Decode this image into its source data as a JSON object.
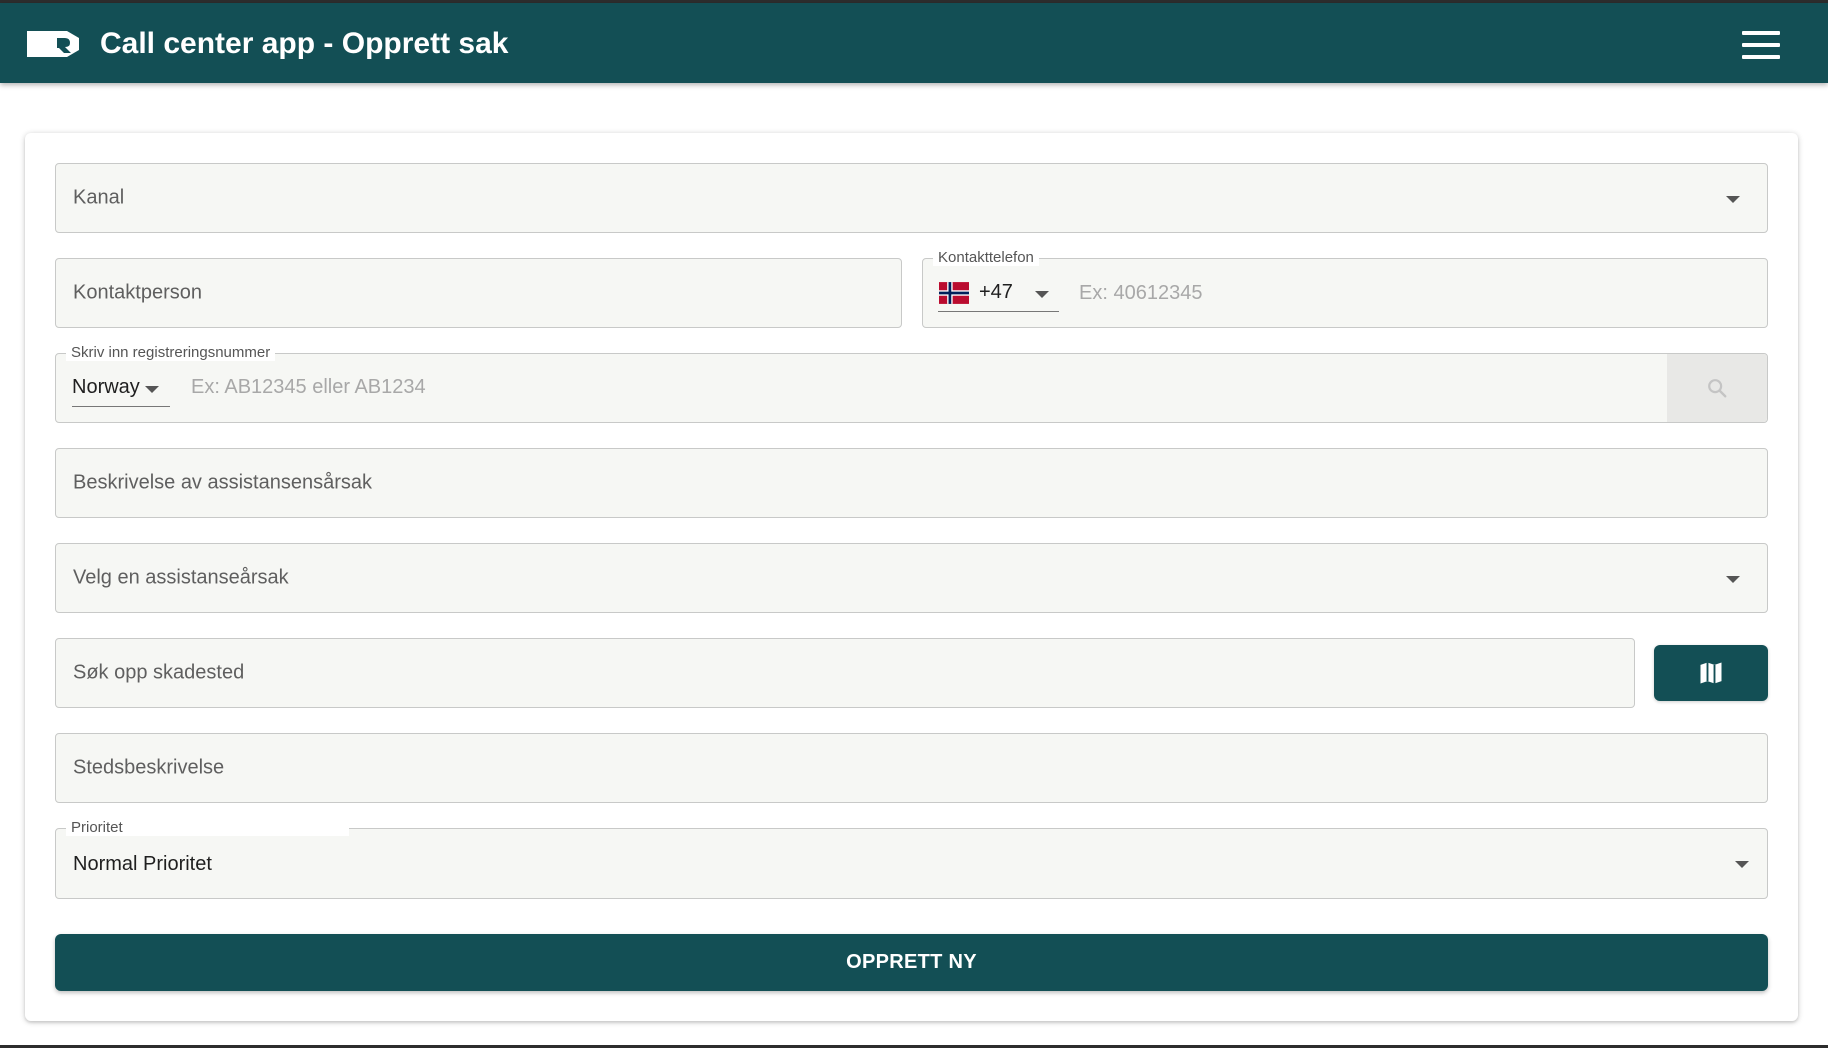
{
  "header": {
    "title": "Call center app - Opprett sak",
    "logo_icon": "company-logo-icon",
    "menu_icon": "hamburger-menu-icon"
  },
  "form": {
    "kanal": {
      "placeholder": "Kanal"
    },
    "kontaktperson": {
      "placeholder": "Kontaktperson"
    },
    "kontakttelefon": {
      "label": "Kontakttelefon",
      "country_code": "+47",
      "placeholder": "Ex: 40612345",
      "flag": "norway-flag-icon"
    },
    "registration": {
      "label": "Skriv inn registreringsnummer",
      "country": "Norway",
      "placeholder": "Ex: AB12345 eller AB1234",
      "search_icon": "search-icon"
    },
    "beskrivelse": {
      "placeholder": "Beskrivelse av assistansensårsak"
    },
    "assistanse_arsak": {
      "placeholder": "Velg en assistanseårsak"
    },
    "skadested": {
      "placeholder": "Søk opp skadested",
      "map_icon": "map-icon"
    },
    "stedsbeskrivelse": {
      "placeholder": "Stedsbeskrivelse"
    },
    "prioritet": {
      "label": "Prioritet",
      "value": "Normal Prioritet"
    },
    "submit_label": "OPPRETT NY"
  },
  "colors": {
    "primary": "#134f55",
    "field_bg": "#f6f7f4",
    "field_border": "#c8c9c8"
  }
}
